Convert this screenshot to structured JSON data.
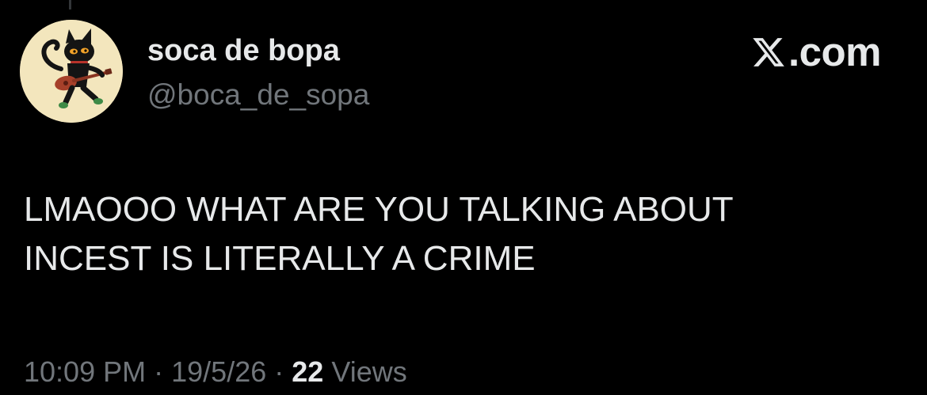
{
  "tweet": {
    "author": {
      "display_name": "soca de bopa",
      "handle": "@boca_de_sopa",
      "avatar_icon": "cat-playing-guitar-avatar"
    },
    "watermark": {
      "logo_icon": "x-logo-icon",
      "text": ".com"
    },
    "text_lines": [
      "LMAOOO WHAT ARE YOU TALKING ABOUT",
      "INCEST IS LITERALLY A CRIME"
    ],
    "meta": {
      "time": "10:09 PM",
      "separator": "·",
      "date": "19/5/26",
      "views_count": "22",
      "views_label": "Views"
    }
  },
  "colors": {
    "background": "#000000",
    "primary_text": "#e7e9ea",
    "secondary_text": "#71767b",
    "avatar_bg": "#f3e6bd"
  }
}
